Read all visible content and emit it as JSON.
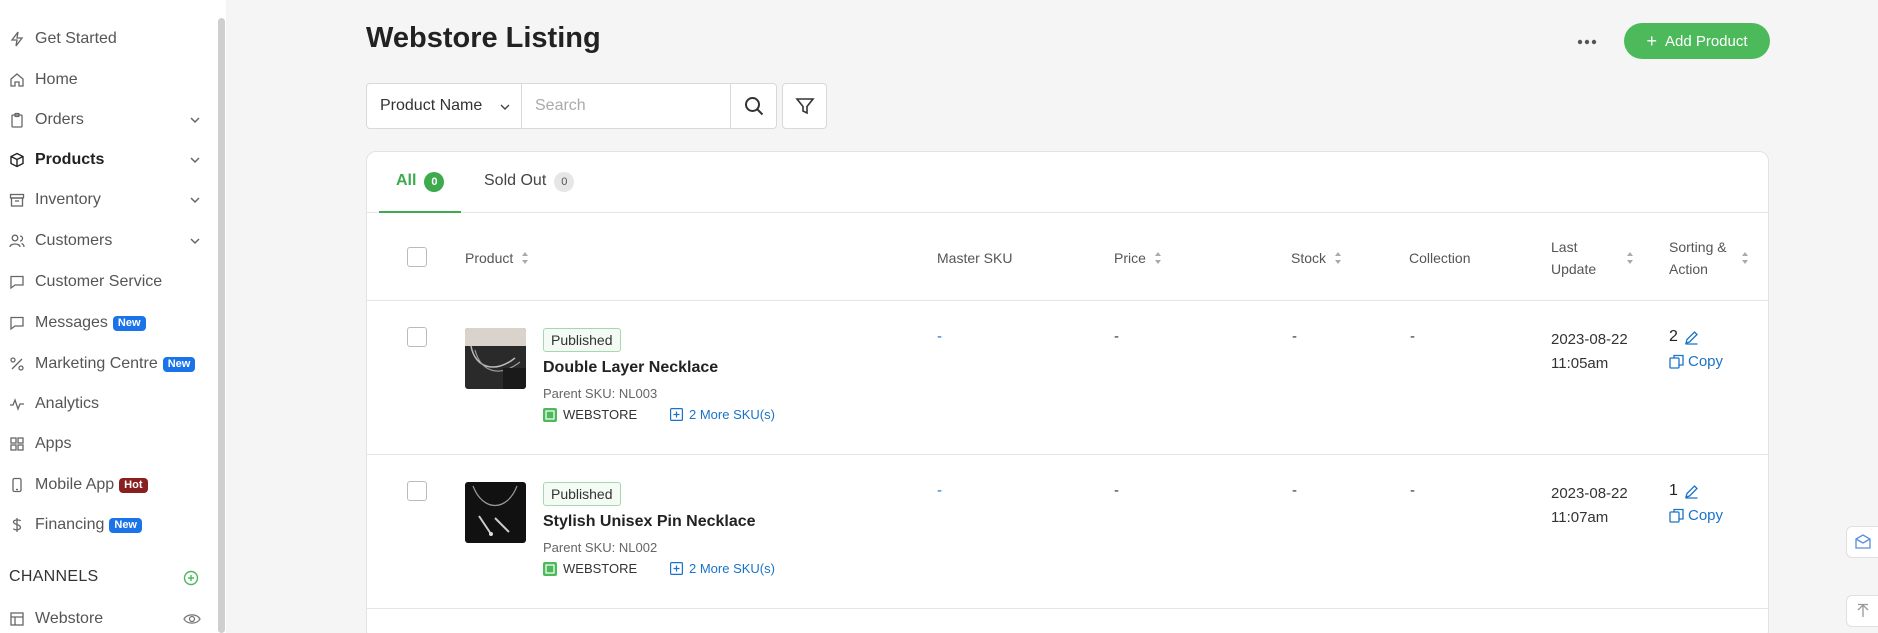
{
  "sidebar": {
    "items": [
      {
        "label": "Get Started",
        "icon": "bolt-icon"
      },
      {
        "label": "Home",
        "icon": "home-icon"
      },
      {
        "label": "Orders",
        "icon": "clipboard-icon"
      },
      {
        "label": "Products",
        "icon": "box-icon"
      },
      {
        "label": "Inventory",
        "icon": "archive-icon"
      },
      {
        "label": "Customers",
        "icon": "users-icon"
      },
      {
        "label": "Customer Service",
        "icon": "chat-icon"
      },
      {
        "label": "Messages",
        "icon": "message-icon",
        "badge": "New"
      },
      {
        "label": "Marketing Centre",
        "icon": "percent-icon",
        "badge": "New"
      },
      {
        "label": "Analytics",
        "icon": "analytics-icon"
      },
      {
        "label": "Apps",
        "icon": "grid-icon"
      },
      {
        "label": "Mobile App",
        "icon": "phone-icon",
        "badge": "Hot"
      },
      {
        "label": "Financing",
        "icon": "dollar-icon",
        "badge": "New"
      }
    ],
    "channels_title": "CHANNELS",
    "channel_items": [
      {
        "label": "Webstore",
        "icon": "layout-icon"
      }
    ]
  },
  "header": {
    "title": "Webstore Listing",
    "add_button_label": "Add Product"
  },
  "search": {
    "field_select": "Product Name",
    "placeholder": "Search"
  },
  "tabs": [
    {
      "label": "All",
      "count": "0"
    },
    {
      "label": "Sold Out",
      "count": "0"
    }
  ],
  "table": {
    "columns": {
      "product": "Product",
      "master_sku": "Master SKU",
      "price": "Price",
      "stock": "Stock",
      "collection": "Collection",
      "last_update_1": "Last",
      "last_update_2": "Update",
      "sorting_1": "Sorting &",
      "sorting_2": "Action"
    },
    "rows": [
      {
        "status": "Published",
        "name": "Double Layer Necklace",
        "parent_sku": "Parent SKU: NL003",
        "channel": "WEBSTORE",
        "more_sku": "2 More SKU(s)",
        "master_sku": "-",
        "price": "-",
        "stock": "-",
        "collection": "-",
        "date": "2023-08-22",
        "time": "11:05am",
        "sort": "2",
        "copy": "Copy"
      },
      {
        "status": "Published",
        "name": "Stylish Unisex Pin Necklace",
        "parent_sku": "Parent SKU: NL002",
        "channel": "WEBSTORE",
        "more_sku": "2 More SKU(s)",
        "master_sku": "-",
        "price": "-",
        "stock": "-",
        "collection": "-",
        "date": "2023-08-22",
        "time": "11:07am",
        "sort": "1",
        "copy": "Copy"
      }
    ]
  },
  "colors": {
    "accent": "#4cba5b",
    "link": "#1a73c8",
    "badge_new": "#1a73e8",
    "badge_hot": "#8a1f1f"
  }
}
